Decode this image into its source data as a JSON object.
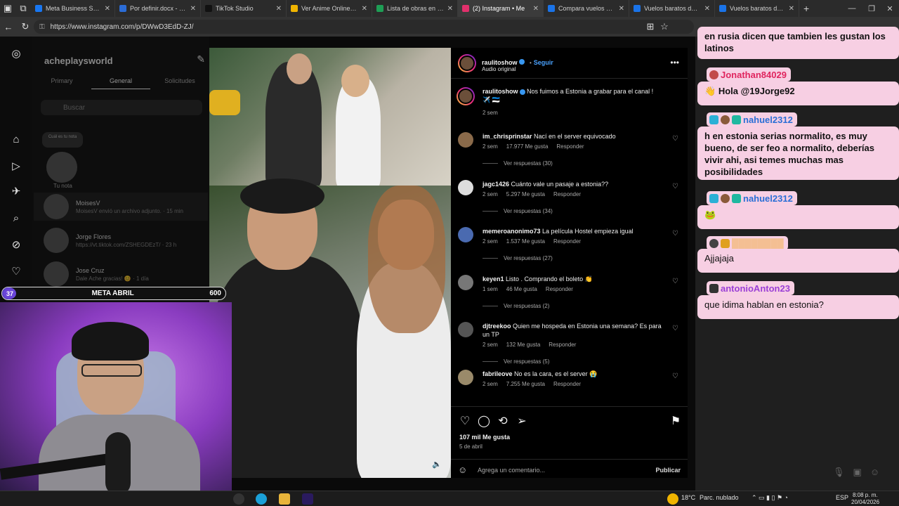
{
  "browser": {
    "tabs": [
      {
        "title": "Meta Business Suite",
        "color": "#1877f2",
        "active": false
      },
      {
        "title": "Por definir.docx - Docu",
        "color": "#2b6cd6",
        "active": false
      },
      {
        "title": "TikTok Studio",
        "color": "#111111",
        "active": false
      },
      {
        "title": "Ver Anime Online - todo",
        "color": "#f0b400",
        "active": false
      },
      {
        "title": "Lista de obras en seguir",
        "color": "#1e9e55",
        "active": false
      },
      {
        "title": "(2) Instagram • Me",
        "color": "#e1306c",
        "active": true
      },
      {
        "title": "Compara vuelos barato",
        "color": "#1a73e8",
        "active": false
      },
      {
        "title": "Vuelos baratos desde M",
        "color": "#1a73e8",
        "active": false
      },
      {
        "title": "Vuelos baratos de Mé",
        "color": "#1a73e8",
        "active": false
      }
    ],
    "new_tab": "+",
    "url": "https://www.instagram.com/p/DWwD3EdD-ZJ/"
  },
  "instagram": {
    "dm": {
      "username": "acheplaysworld",
      "tabs": [
        "Primary",
        "General",
        "Solicitudes"
      ],
      "active_tab": "General",
      "search_placeholder": "Buscar",
      "note_label": "Tu nota",
      "note_bubble": "Cuál es tu nota",
      "conversations": [
        {
          "name": "MoisesV",
          "sub": "MoisesV envió un archivo adjunto. · 15 min"
        },
        {
          "name": "Jorge Flores",
          "sub": "https://vt.tiktok.com/ZSHEGDEzT/ · 23 h"
        },
        {
          "name": "Jose Cruz",
          "sub": "Dale Ache gracias! 😊 · 1 día"
        }
      ]
    },
    "post": {
      "author": "raulitoshow",
      "follow": "Seguir",
      "audio": "Audio original",
      "caption": "Nos fuimos a Estonia a grabar para el canal ! ✈️ 🇪🇪",
      "caption_time": "2 sem",
      "comments": [
        {
          "user": "im_chrisprinstar",
          "text": "Nací en el server equivocado",
          "time": "2 sem",
          "likes": "17.977 Me gusta",
          "reply": "Responder",
          "replies": "Ver respuestas (30)"
        },
        {
          "user": "jagc1426",
          "text": "Cuánto vale un pasaje a estonia??",
          "time": "2 sem",
          "likes": "5.297 Me gusta",
          "reply": "Responder",
          "replies": "Ver respuestas (34)"
        },
        {
          "user": "memeroanonimo73",
          "text": "La película Hostel empieza igual",
          "time": "2 sem",
          "likes": "1.537 Me gusta",
          "reply": "Responder",
          "replies": "Ver respuestas (27)"
        },
        {
          "user": "keyen1",
          "text": "Listo . Comprando el boleto 👏",
          "time": "1 sem",
          "likes": "46 Me gusta",
          "reply": "Responder",
          "replies": "Ver respuestas (2)"
        },
        {
          "user": "djtreekoo",
          "text": "Quien me hospeda en Estonia una semana? Es para un TP",
          "time": "2 sem",
          "likes": "132 Me gusta",
          "reply": "Responder",
          "replies": "Ver respuestas (5)"
        },
        {
          "user": "fabrileove",
          "text": "No es la cara, es el server 😭",
          "time": "2 sem",
          "likes": "7.255 Me gusta",
          "reply": "Responder",
          "replies": ""
        }
      ],
      "likes": "107 mil Me gusta",
      "date": "5 de abril",
      "comment_placeholder": "Agrega un comentario...",
      "publish": "Publicar"
    }
  },
  "chat": {
    "messages": [
      {
        "user": "",
        "text": "en rusia dicen que tambien les gustan los latinos",
        "user_color": ""
      },
      {
        "user": "Jonathan84029",
        "text": "Hola @19Jorge92",
        "user_color": "#e0245e"
      },
      {
        "user": "nahuel2312",
        "text": "h en estonia serias normalito, es muy bueno, de ser feo a normalito, deberías vivir ahi, asi temes muchas mas posibilidades",
        "user_color": "#2b6fd6"
      },
      {
        "user": "nahuel2312",
        "text": "🐸",
        "user_color": "#2b6fd6"
      },
      {
        "user": "",
        "text": "Ajjajaja",
        "user_color": "#f0a400"
      },
      {
        "user": "antonioAnton23",
        "text": "que idima hablan en estonia?",
        "user_color": "#9b3fd6"
      }
    ]
  },
  "stream": {
    "goal_left": "37",
    "goal_label": "META ABRIL",
    "goal_right": "600",
    "goal_progress": 0.06
  },
  "taskbar": {
    "weather": "18°C",
    "weather_desc": "Parc. nublado",
    "lang": "ESP",
    "time": "8:08 p. m.",
    "date": "20/04/2026"
  }
}
